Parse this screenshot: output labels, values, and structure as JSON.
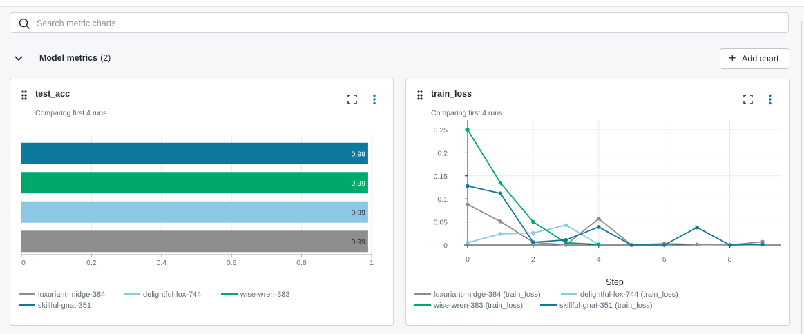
{
  "search": {
    "placeholder": "Search metric charts"
  },
  "section": {
    "title": "Model metrics",
    "count": "(2)"
  },
  "toolbar": {
    "add_chart_label": "Add chart"
  },
  "colors": {
    "luxuriant": "#8e8e8e",
    "delightful": "#8ac9e6",
    "wise": "#00a86b",
    "skillful": "#0c7a9e"
  },
  "cards": [
    {
      "title": "test_acc",
      "subtitle": "Comparing first 4 runs"
    },
    {
      "title": "train_loss",
      "subtitle": "Comparing first 4 runs"
    }
  ],
  "legend_acc": [
    {
      "label": "luxuriant-midge-384",
      "color": "#8e8e8e"
    },
    {
      "label": "delightful-fox-744",
      "color": "#8ac9e6"
    },
    {
      "label": "wise-wren-383",
      "color": "#00a86b"
    },
    {
      "label": "skillful-gnat-351",
      "color": "#0c7a9e"
    }
  ],
  "legend_loss": [
    {
      "label": "luxuriant-midge-384 (train_loss)",
      "color": "#8e8e8e"
    },
    {
      "label": "delightful-fox-744 (train_loss)",
      "color": "#8ac9e6"
    },
    {
      "label": "wise-wren-383 (train_loss)",
      "color": "#00a86b"
    },
    {
      "label": "skillful-gnat-351 (train_loss)",
      "color": "#0c7a9e"
    }
  ],
  "chart_data": [
    {
      "type": "bar",
      "orientation": "horizontal",
      "title": "test_acc",
      "subtitle": "Comparing first 4 runs",
      "xlim": [
        0,
        1
      ],
      "x_ticks": [
        "0",
        "0.2",
        "0.4",
        "0.6",
        "0.8",
        "1"
      ],
      "grid": true,
      "legend_position": "bottom",
      "series": [
        {
          "name": "skillful-gnat-351",
          "value": 0.99,
          "label": "0.99",
          "color": "#0c7a9e"
        },
        {
          "name": "wise-wren-383",
          "value": 0.99,
          "label": "0.99",
          "color": "#00a86b"
        },
        {
          "name": "delightful-fox-744",
          "value": 0.99,
          "label": "0.99",
          "color": "#8ac9e6"
        },
        {
          "name": "luxuriant-midge-384",
          "value": 0.99,
          "label": "0.99",
          "color": "#8e8e8e"
        }
      ]
    },
    {
      "type": "line",
      "title": "train_loss",
      "subtitle": "Comparing first 4 runs",
      "xlabel": "Step",
      "ylabel": "",
      "xlim": [
        0,
        9
      ],
      "ylim": [
        0,
        0.25
      ],
      "x_ticks": [
        "0",
        "2",
        "4",
        "6",
        "8"
      ],
      "y_ticks": [
        "0",
        "0.05",
        "0.1",
        "0.15",
        "0.2",
        "0.25"
      ],
      "grid": true,
      "legend_position": "bottom",
      "series": [
        {
          "name": "luxuriant-midge-384 (train_loss)",
          "color": "#8e8e8e",
          "x": [
            0,
            1,
            2,
            3,
            4,
            5,
            6,
            7,
            8,
            9
          ],
          "y": [
            0.088,
            0.051,
            0.006,
            0.0,
            0.057,
            0.0,
            0.003,
            0.001,
            0.0,
            0.007
          ]
        },
        {
          "name": "delightful-fox-744 (train_loss)",
          "color": "#8ac9e6",
          "x": [
            0,
            1,
            2,
            3,
            4
          ],
          "y": [
            0.005,
            0.024,
            0.026,
            0.043,
            0.001
          ]
        },
        {
          "name": "wise-wren-383 (train_loss)",
          "color": "#00a86b",
          "x": [
            0,
            1,
            2,
            3,
            4
          ],
          "y": [
            0.25,
            0.135,
            0.05,
            0.005,
            0.001
          ]
        },
        {
          "name": "skillful-gnat-351 (train_loss)",
          "color": "#0c7a9e",
          "x": [
            0,
            1,
            2,
            3,
            4,
            5,
            6,
            7,
            8,
            9
          ],
          "y": [
            0.128,
            0.112,
            0.006,
            0.011,
            0.039,
            0.0,
            0.0,
            0.038,
            0.0,
            0.001
          ]
        }
      ]
    }
  ]
}
